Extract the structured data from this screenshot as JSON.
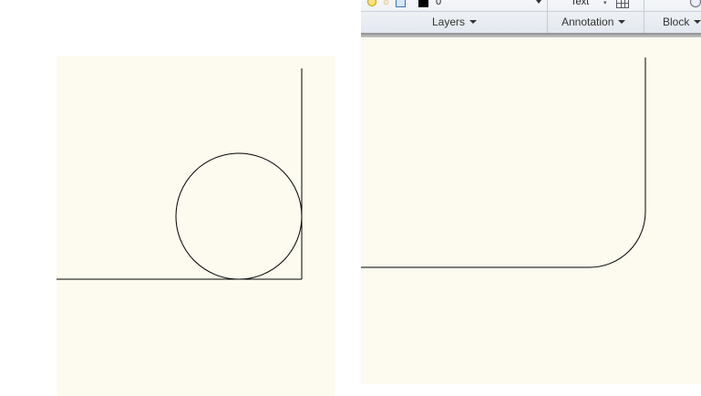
{
  "ribbon": {
    "layer_value": "0",
    "text_label": "Text",
    "panels": {
      "layers": "Layers",
      "annotation": "Annotation",
      "block": "Block"
    }
  },
  "icons": [
    "bulb-icon",
    "sun-icon",
    "lock-icon",
    "layer-color-swatch",
    "dropdown-arrow-icon",
    "table-icon",
    "insert-icon"
  ],
  "colors": {
    "canvas": "#fdfbf0",
    "ribbon": "#e8ecf1",
    "line": "#000000"
  }
}
